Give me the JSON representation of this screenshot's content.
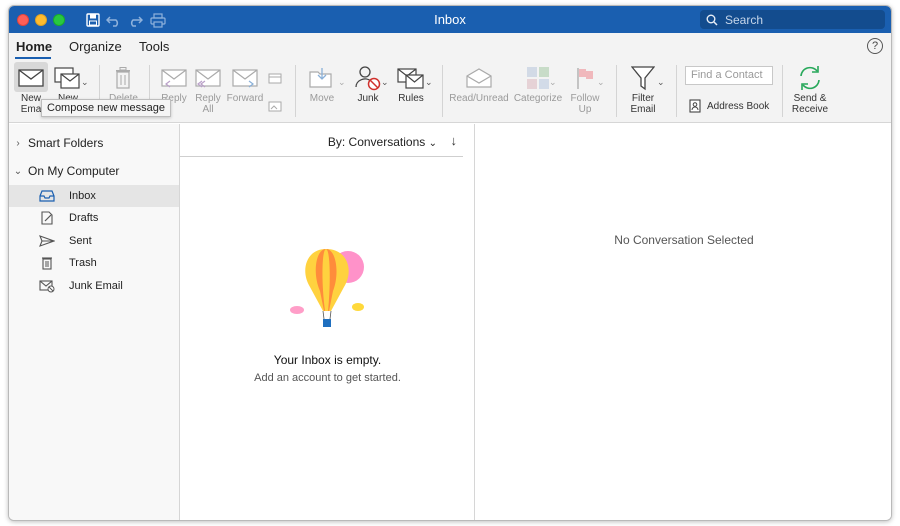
{
  "window": {
    "title": "Inbox"
  },
  "search": {
    "placeholder": "Search"
  },
  "tabs": [
    {
      "label": "Home"
    },
    {
      "label": "Organize"
    },
    {
      "label": "Tools"
    }
  ],
  "ribbon": {
    "new_email_partial": [
      "New",
      "Ema"
    ],
    "new_items_partial": "New",
    "delete_partial": "Delete",
    "reply": "Reply",
    "reply_all": [
      "Reply",
      "All"
    ],
    "forward": "Forward",
    "move": "Move",
    "junk": "Junk",
    "rules": "Rules",
    "read_unread": "Read/Unread",
    "categorize": "Categorize",
    "follow_up": [
      "Follow",
      "Up"
    ],
    "filter_email": [
      "Filter",
      "Email"
    ],
    "find_contact_placeholder": "Find a Contact",
    "address_book": "Address Book",
    "send_receive": [
      "Send &",
      "Receive"
    ]
  },
  "tooltip": "Compose new message",
  "sidebar": {
    "smart_folders": "Smart Folders",
    "on_my_computer": "On My Computer",
    "folders": [
      {
        "label": "Inbox",
        "icon": "inbox-icon"
      },
      {
        "label": "Drafts",
        "icon": "drafts-icon"
      },
      {
        "label": "Sent",
        "icon": "sent-icon"
      },
      {
        "label": "Trash",
        "icon": "trash-icon"
      },
      {
        "label": "Junk Email",
        "icon": "junk-email-icon"
      }
    ]
  },
  "message_list": {
    "sort_label": "By: Conversations",
    "empty_title": "Your Inbox is empty.",
    "empty_subtitle": "Add an account to get started."
  },
  "reading_pane": {
    "empty_text": "No Conversation Selected"
  },
  "colors": {
    "titlebar": "#1a5fb0",
    "accent": "#1a5fb0",
    "send_receive": "#27a85a"
  }
}
